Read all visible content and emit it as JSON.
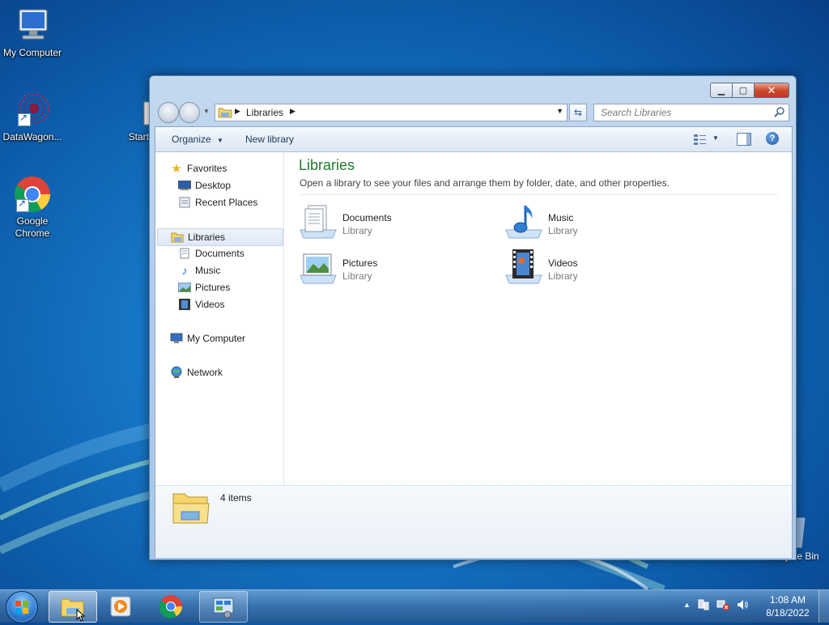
{
  "desktop": {
    "icons": [
      {
        "label": "My Computer"
      },
      {
        "label": "DataWagon..."
      },
      {
        "label": "Start"
      },
      {
        "label": "Google Chrome"
      },
      {
        "label": "Recycle Bin"
      }
    ]
  },
  "window": {
    "address": {
      "crumb": "Libraries"
    },
    "search": {
      "placeholder": "Search Libraries"
    },
    "toolbar": {
      "organize": "Organize",
      "new_library": "New library"
    },
    "nav": {
      "favorites": "Favorites",
      "desktop": "Desktop",
      "recent_places": "Recent Places",
      "libraries": "Libraries",
      "documents": "Documents",
      "music": "Music",
      "pictures": "Pictures",
      "videos": "Videos",
      "my_computer": "My Computer",
      "network": "Network"
    },
    "content": {
      "heading": "Libraries",
      "description": "Open a library to see your files and arrange them by folder, date, and other properties.",
      "items": [
        {
          "name": "Documents",
          "type": "Library",
          "icon": "documents-library-icon"
        },
        {
          "name": "Music",
          "type": "Library",
          "icon": "music-library-icon"
        },
        {
          "name": "Pictures",
          "type": "Library",
          "icon": "pictures-library-icon"
        },
        {
          "name": "Videos",
          "type": "Library",
          "icon": "videos-library-icon"
        }
      ]
    },
    "details": {
      "count": "4 items"
    }
  },
  "taskbar": {
    "clock_time": "1:08 AM",
    "clock_date": "8/18/2022",
    "tray_chevron": "▲"
  }
}
